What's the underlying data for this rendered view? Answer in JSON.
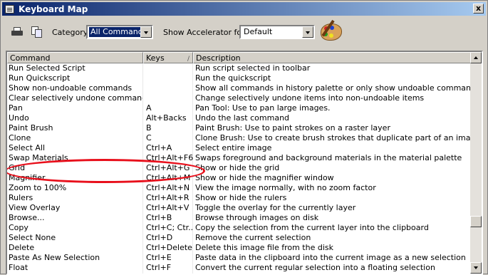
{
  "window": {
    "title": "Keyboard Map",
    "close_label": "x"
  },
  "toolbar": {
    "category_label": "Category:",
    "category_value": "All Commands",
    "accelerator_label": "Show Accelerator for:",
    "accelerator_value": "Default",
    "print_icon": "printer-icon",
    "copy_icon": "copy-icon",
    "palette_icon": "palette-icon"
  },
  "table": {
    "headers": [
      "Command",
      "Keys",
      "Description"
    ],
    "sorted_column": "Keys",
    "rows": [
      [
        "Run Selected Script",
        "",
        "Run script selected in toolbar"
      ],
      [
        "Run Quickscript",
        "",
        "Run the quickscript"
      ],
      [
        "Show non-undoable commands",
        "",
        "Show all commands in history palette or only show undoable commands"
      ],
      [
        "Clear selectively undone commands",
        "",
        "Change selectively undone items into non-undoable items"
      ],
      [
        "Pan",
        "A",
        "Pan Tool: Use to pan large images."
      ],
      [
        "Undo",
        "Alt+Backs",
        "Undo the last command"
      ],
      [
        "Paint Brush",
        "B",
        "Paint Brush: Use to paint strokes on a raster layer"
      ],
      [
        "Clone",
        "C",
        "Clone Brush: Use to create brush strokes that duplicate part of an image"
      ],
      [
        "Select All",
        "Ctrl+A",
        "Select entire image"
      ],
      [
        "Swap Materials",
        "Ctrl+Alt+F6",
        "Swaps foreground and background materials in the material palette"
      ],
      [
        "Grid",
        "Ctrl+Alt+G",
        "Show or hide the grid"
      ],
      [
        "Magnifier",
        "Ctrl+Alt+M",
        "Show or hide the magnifier window"
      ],
      [
        "Zoom to 100%",
        "Ctrl+Alt+N",
        "View the image normally, with no zoom factor"
      ],
      [
        "Rulers",
        "Ctrl+Alt+R",
        "Show or hide the rulers"
      ],
      [
        "View Overlay",
        "Ctrl+Alt+V",
        "Toggle the overlay for the currently layer"
      ],
      [
        "Browse...",
        "Ctrl+B",
        "Browse through images on disk"
      ],
      [
        "Copy",
        "Ctrl+C; Ctr...",
        "Copy the selection from the current layer into the clipboard"
      ],
      [
        "Select None",
        "Ctrl+D",
        "Remove the current selection"
      ],
      [
        "Delete",
        "Ctrl+Delete",
        "Delete this image file from the disk"
      ],
      [
        "Paste As New Selection",
        "Ctrl+E",
        "Paste data in the clipboard into the current image as a new selection"
      ],
      [
        "Float",
        "Ctrl+F",
        "Convert the current regular selection into a floating selection"
      ]
    ]
  },
  "annotation": {
    "highlighted_row": "Undo",
    "color": "#e8101c"
  }
}
